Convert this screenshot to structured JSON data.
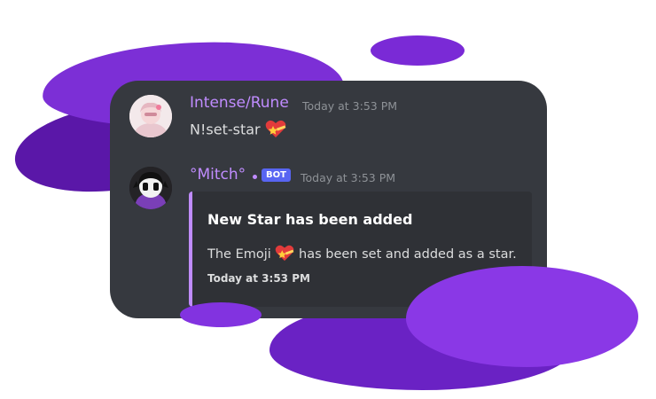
{
  "messages": [
    {
      "author": "Intense/Rune",
      "timestamp": "Today at 3:53 PM",
      "content": "N!set-star",
      "emoji": "star-heart-emoji",
      "avatar": "user-avatar"
    },
    {
      "author": "°Mitch°",
      "badge": "BOT",
      "timestamp": "Today at 3:53 PM",
      "avatar": "bot-avatar",
      "embed": {
        "title": "New Star has been added",
        "desc_before": "The Emoji",
        "desc_after": "has been set and added as a star.",
        "footer": "Today at 3:53 PM",
        "accent": "#c08cff"
      }
    }
  ],
  "colors": {
    "card_bg": "#36393f",
    "embed_bg": "#2f3136",
    "username": "#c08cff",
    "blob_purple": "#7c2fd6"
  }
}
